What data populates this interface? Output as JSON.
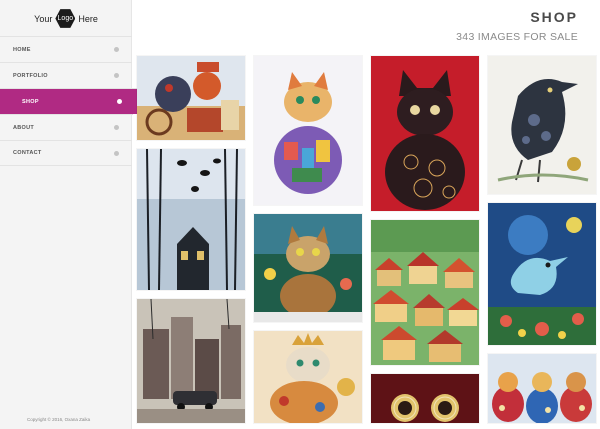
{
  "logo": {
    "left": "Your",
    "center": "Logo",
    "right": "Here"
  },
  "nav": {
    "items": [
      {
        "label": "HOME"
      },
      {
        "label": "PORTFOLIO"
      },
      {
        "label": "SHOP"
      },
      {
        "label": "ABOUT"
      },
      {
        "label": "CONTACT"
      }
    ],
    "active_item": "SHOP",
    "accent_color": "#b02a83"
  },
  "copyright": "Copyright © 2016, Oxana Zaika",
  "header": {
    "title": "SHOP",
    "subtitle": "343 IMAGES FOR SALE"
  },
  "gallery": {
    "tiles": [
      {
        "subject": "cat-with-turkey-and-cart"
      },
      {
        "subject": "colorful-cat-with-town"
      },
      {
        "subject": "black-cat-on-red"
      },
      {
        "subject": "raven"
      },
      {
        "subject": "trees-with-birds"
      },
      {
        "subject": "cat-in-flowers"
      },
      {
        "subject": "red-roofs-town"
      },
      {
        "subject": "blue-bird-fantasy"
      },
      {
        "subject": "old-town-with-car"
      },
      {
        "subject": "cat-with-crown"
      },
      {
        "subject": "owl"
      },
      {
        "subject": "folk-cats"
      }
    ]
  }
}
